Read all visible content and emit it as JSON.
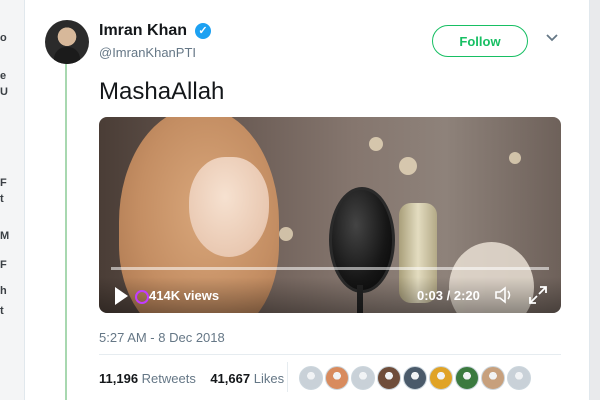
{
  "background": {
    "letters": [
      "o",
      "e",
      "U",
      "F",
      "t",
      "M",
      "F",
      "h",
      "t"
    ]
  },
  "tweet": {
    "author_name": "Imran Khan",
    "handle": "@ImranKhanPTI",
    "follow_label": "Follow",
    "text": "MashaAllah",
    "timestamp": "5:27 AM - 8 Dec 2018",
    "retweets_count": "11,196",
    "retweets_label": "Retweets",
    "likes_count": "41,667",
    "likes_label": "Likes"
  },
  "video": {
    "views": "414K views",
    "time": "0:03 / 2:20"
  },
  "likers": [
    {
      "color": "#c9d1d8"
    },
    {
      "color": "#d88b5e"
    },
    {
      "color": "#c9d1d8"
    },
    {
      "color": "#6f4d3a"
    },
    {
      "color": "#4a5a6a"
    },
    {
      "color": "#e0a326"
    },
    {
      "color": "#3b7a3f"
    },
    {
      "color": "#c7a07d"
    },
    {
      "color": "#c9d1d8"
    }
  ],
  "colors": {
    "accent_green": "#17bf63",
    "verified_blue": "#1da1f2",
    "thread_line": "#a8d8b0"
  }
}
